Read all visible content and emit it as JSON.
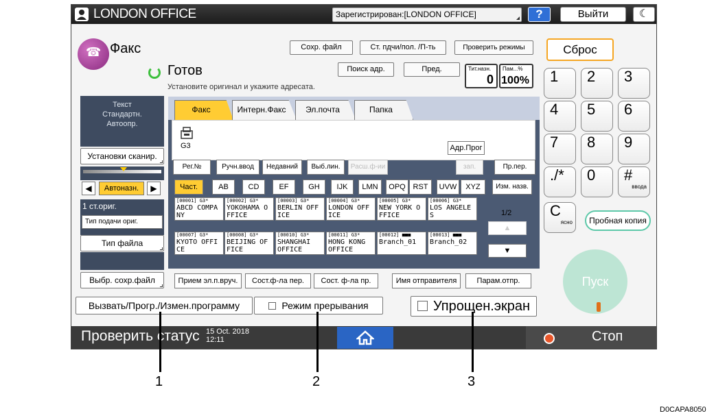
{
  "topbar": {
    "office_name": "LONDON OFFICE",
    "registered": "Зарегистрирован:[LONDON OFFICE]",
    "help_label": "?",
    "logout_label": "Выйти",
    "moon_label": "☾"
  },
  "app": {
    "name": "Факс",
    "save_file": "Сохр. файл",
    "feed_side": "Ст. пдчи/пол. /П-ть",
    "check_modes": "Проверить режимы",
    "status": "Готов",
    "status_hint": "Установите оригинал и укажите адресата.",
    "addr_search": "Поиск адр.",
    "prev": "Пред.",
    "counter_dest_label": "Тит.назн.",
    "counter_dest_value": "0",
    "counter_mem_label": "Пам...%",
    "counter_mem_value": "100%"
  },
  "left_panel": {
    "scan_summary_1": "Текст",
    "scan_summary_2": "Стандартн.",
    "scan_summary_3": "Автоопр.",
    "scan_settings": "Установки сканир.",
    "density_left": "◀",
    "density_auto": "Автоназн.",
    "density_right": "▶",
    "orig_count": "1 ст.ориг.",
    "feed_type": "Тип подачи ориг.",
    "file_type": "Тип файла",
    "select_stored": "Выбр. сохр.файл"
  },
  "tabs": [
    "Факс",
    "Интерн.Факс",
    "Эл.почта",
    "Папка"
  ],
  "destination": {
    "type": "G3",
    "addr_prog": "Адр.Прог"
  },
  "toolbar": {
    "reg_no": "Рег.№",
    "manual": "Ручн.ввод",
    "recent": "Недавний",
    "line": "Выб.лин.",
    "ext": "Расш.ф-ии",
    "misc": "зап.",
    "pr_per": "Пр.пер."
  },
  "index": [
    "Част.",
    "AB",
    "CD",
    "EF",
    "GH",
    "IJK",
    "LMN",
    "OPQ",
    "RST",
    "UVW",
    "XYZ"
  ],
  "index_edit": "Изм. назв.",
  "dest_cells": [
    {
      "hd": "[00001] G3*",
      "line1": "ABCD COMPA",
      "line2": "NY"
    },
    {
      "hd": "[00002] G3*",
      "line1": "YOKOHAMA O",
      "line2": "FFICE"
    },
    {
      "hd": "[00003] G3*",
      "line1": "BERLIN OFF",
      "line2": "ICE"
    },
    {
      "hd": "[00004] G3*",
      "line1": "LONDON OFF",
      "line2": "ICE"
    },
    {
      "hd": "[00005] G3*",
      "line1": "NEW YORK O",
      "line2": "FFICE"
    },
    {
      "hd": "[00006] G3*",
      "line1": "LOS ANGELE",
      "line2": "S"
    },
    {
      "hd": "[00007] G3*",
      "line1": "KYOTO OFFI",
      "line2": "CE"
    },
    {
      "hd": "[00008] G3*",
      "line1": "BEIJING OF",
      "line2": "FICE"
    },
    {
      "hd": "[00010] G3*",
      "line1": "SHANGHAI",
      "line2": "OFFICE"
    },
    {
      "hd": "[00011] G3*",
      "line1": "HONG KONG",
      "line2": "OFFICE"
    },
    {
      "hd": "[00012] ■■■",
      "line1": "Branch_01",
      "line2": ""
    },
    {
      "hd": "[00013] ■■■",
      "line1": "Branch_02",
      "line2": ""
    }
  ],
  "paging": {
    "indicator": "1/2",
    "up": "▲",
    "down": "▼"
  },
  "bottom_row": {
    "manual_rx": "Прием эл.п.вруч.",
    "stored_send": "Сост.ф-ла пер.",
    "stored_rx": "Сост. ф-ла пр.",
    "sender_name": "Имя отправителя",
    "send_params": "Парам.отпр."
  },
  "keypad": {
    "reset": "Сброс",
    "keys": [
      "1",
      "2",
      "3",
      "4",
      "5",
      "6",
      "7",
      "8",
      "9",
      "./*",
      "0",
      "#"
    ],
    "hash_sub": "ввода",
    "clear": "C",
    "clear_sub": "ясно",
    "trial": "Пробная копия",
    "start": "Пуск"
  },
  "footer_buttons": {
    "program": "Вызвать/Прогр./Измен.программу",
    "interrupt": "Режим прерывания",
    "simplified": "Упрощен.экран"
  },
  "statusbar": {
    "check_status": "Проверить статус",
    "date": "15 Oct. 2018",
    "time": "12:11",
    "home": "⌂",
    "stop": "Стоп"
  },
  "callouts": [
    "1",
    "2",
    "3"
  ],
  "image_code": "D0CAPA8050",
  "colors": {
    "accent": "#ffcc33",
    "home": "#2a65c4",
    "stop": "#e8562a",
    "start": "#bde5d4",
    "reset_border": "#f5a623"
  }
}
